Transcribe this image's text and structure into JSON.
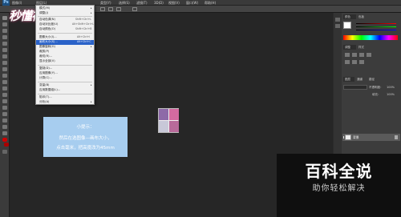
{
  "app": {
    "logo": "Ps",
    "menus": [
      "图像(I)",
      "图层(L)",
      "类型(Y)",
      "选择(S)",
      "滤镜(T)",
      "3D(D)",
      "视图(V)",
      "窗口(W)",
      "帮助(H)"
    ],
    "workspace": "基本功能"
  },
  "watermark": "秒懂视频",
  "image_menu": {
    "items": [
      {
        "label": "模式(M)",
        "shortcut": "",
        "submenu": true
      },
      {
        "label": "调整(J)",
        "shortcut": "",
        "submenu": true
      },
      {
        "label": "自动色调(N)",
        "shortcut": "Shift+Ctrl+L",
        "submenu": false
      },
      {
        "label": "自动对比度(U)",
        "shortcut": "Alt+Shift+Ctrl+L",
        "submenu": false
      },
      {
        "label": "自动颜色(O)",
        "shortcut": "Shift+Ctrl+B",
        "submenu": false
      },
      {
        "label": "图像大小(I)...",
        "shortcut": "Alt+Ctrl+I",
        "submenu": false
      },
      {
        "label": "画布大小(S)...",
        "shortcut": "Alt+Ctrl+C",
        "submenu": false,
        "highlighted": true
      },
      {
        "label": "图像旋转(G)",
        "shortcut": "",
        "submenu": true
      },
      {
        "label": "裁剪(P)",
        "shortcut": "",
        "submenu": false
      },
      {
        "label": "裁切(R)...",
        "shortcut": "",
        "submenu": false
      },
      {
        "label": "显示全部(V)",
        "shortcut": "",
        "submenu": false
      },
      {
        "label": "复制(D)...",
        "shortcut": "",
        "submenu": false
      },
      {
        "label": "应用图像(Y)...",
        "shortcut": "",
        "submenu": false
      },
      {
        "label": "计算(C)...",
        "shortcut": "",
        "submenu": false
      },
      {
        "label": "变量(B)",
        "shortcut": "",
        "submenu": true
      },
      {
        "label": "应用数据组(L)...",
        "shortcut": "",
        "submenu": false
      },
      {
        "label": "陷印(T)...",
        "shortcut": "",
        "submenu": false
      },
      {
        "label": "分析(A)",
        "shortcut": "",
        "submenu": true
      }
    ]
  },
  "tip": {
    "title": "小提示：",
    "line1": "然后在选图像—画布大小，",
    "line2": "点击毫米，把高度改为45mm"
  },
  "panels": {
    "tabs": [
      "颜色",
      "色板"
    ],
    "adjust_tabs": [
      "调整",
      "样式"
    ],
    "layers_tabs": [
      "图层",
      "通道",
      "路径"
    ],
    "opacity_label": "不透明度：",
    "opacity_value": "100%",
    "fill_label": "填充：",
    "fill_value": "100%",
    "layer_name": "背景",
    "swatch_colors": [
      "#ff0000",
      "#ffff00",
      "#00ff00",
      "#00ffff",
      "#0000ff",
      "#ff00ff",
      "#ffffff",
      "#808080",
      "#000000",
      "#ff8000",
      "#8000ff",
      "#0080ff"
    ]
  },
  "brand": {
    "title": "百科全说",
    "subtitle": "助你轻松解决"
  }
}
